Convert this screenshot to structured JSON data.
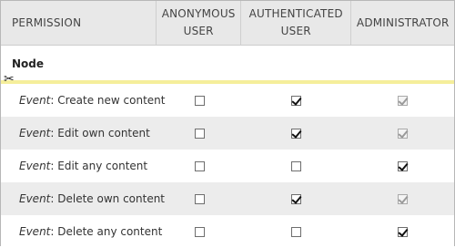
{
  "header": {
    "permission": "PERMISSION",
    "anonymous_line1": "ANONYMOUS",
    "anonymous_line2": "USER",
    "authenticated_line1": "AUTHENTICATED",
    "authenticated_line2": "USER",
    "administrator": "ADMINISTRATOR"
  },
  "section": {
    "label": "Node",
    "scissors_icon": "scissors-icon"
  },
  "rows": [
    {
      "prefix": "Event",
      "label": ": Create new content",
      "anonymous": false,
      "authenticated": true,
      "administrator": true,
      "administrator_disabled": true
    },
    {
      "prefix": "Event",
      "label": ": Edit own content",
      "anonymous": false,
      "authenticated": true,
      "administrator": true,
      "administrator_disabled": true
    },
    {
      "prefix": "Event",
      "label": ": Edit any content",
      "anonymous": false,
      "authenticated": false,
      "administrator": true,
      "administrator_disabled": false
    },
    {
      "prefix": "Event",
      "label": ": Delete own content",
      "anonymous": false,
      "authenticated": true,
      "administrator": true,
      "administrator_disabled": true
    },
    {
      "prefix": "Event",
      "label": ": Delete any content",
      "anonymous": false,
      "authenticated": false,
      "administrator": true,
      "administrator_disabled": false
    }
  ],
  "colors": {
    "header_bg": "#e8e8e8",
    "even_row_bg": "#ececec",
    "cutline": "#f5ee9b"
  }
}
